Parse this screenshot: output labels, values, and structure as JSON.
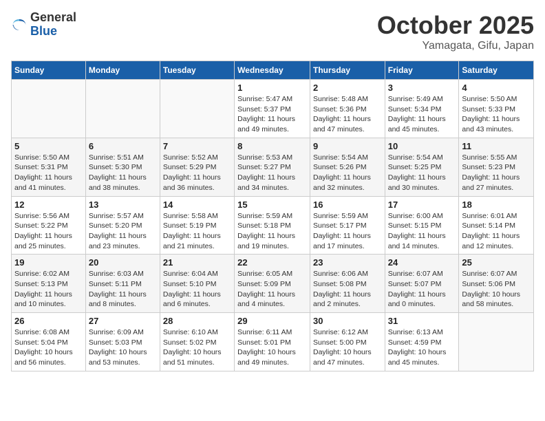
{
  "header": {
    "logo_general": "General",
    "logo_blue": "Blue",
    "month": "October 2025",
    "location": "Yamagata, Gifu, Japan"
  },
  "days_of_week": [
    "Sunday",
    "Monday",
    "Tuesday",
    "Wednesday",
    "Thursday",
    "Friday",
    "Saturday"
  ],
  "weeks": [
    [
      {
        "day": "",
        "info": ""
      },
      {
        "day": "",
        "info": ""
      },
      {
        "day": "",
        "info": ""
      },
      {
        "day": "1",
        "info": "Sunrise: 5:47 AM\nSunset: 5:37 PM\nDaylight: 11 hours\nand 49 minutes."
      },
      {
        "day": "2",
        "info": "Sunrise: 5:48 AM\nSunset: 5:36 PM\nDaylight: 11 hours\nand 47 minutes."
      },
      {
        "day": "3",
        "info": "Sunrise: 5:49 AM\nSunset: 5:34 PM\nDaylight: 11 hours\nand 45 minutes."
      },
      {
        "day": "4",
        "info": "Sunrise: 5:50 AM\nSunset: 5:33 PM\nDaylight: 11 hours\nand 43 minutes."
      }
    ],
    [
      {
        "day": "5",
        "info": "Sunrise: 5:50 AM\nSunset: 5:31 PM\nDaylight: 11 hours\nand 41 minutes."
      },
      {
        "day": "6",
        "info": "Sunrise: 5:51 AM\nSunset: 5:30 PM\nDaylight: 11 hours\nand 38 minutes."
      },
      {
        "day": "7",
        "info": "Sunrise: 5:52 AM\nSunset: 5:29 PM\nDaylight: 11 hours\nand 36 minutes."
      },
      {
        "day": "8",
        "info": "Sunrise: 5:53 AM\nSunset: 5:27 PM\nDaylight: 11 hours\nand 34 minutes."
      },
      {
        "day": "9",
        "info": "Sunrise: 5:54 AM\nSunset: 5:26 PM\nDaylight: 11 hours\nand 32 minutes."
      },
      {
        "day": "10",
        "info": "Sunrise: 5:54 AM\nSunset: 5:25 PM\nDaylight: 11 hours\nand 30 minutes."
      },
      {
        "day": "11",
        "info": "Sunrise: 5:55 AM\nSunset: 5:23 PM\nDaylight: 11 hours\nand 27 minutes."
      }
    ],
    [
      {
        "day": "12",
        "info": "Sunrise: 5:56 AM\nSunset: 5:22 PM\nDaylight: 11 hours\nand 25 minutes."
      },
      {
        "day": "13",
        "info": "Sunrise: 5:57 AM\nSunset: 5:20 PM\nDaylight: 11 hours\nand 23 minutes."
      },
      {
        "day": "14",
        "info": "Sunrise: 5:58 AM\nSunset: 5:19 PM\nDaylight: 11 hours\nand 21 minutes."
      },
      {
        "day": "15",
        "info": "Sunrise: 5:59 AM\nSunset: 5:18 PM\nDaylight: 11 hours\nand 19 minutes."
      },
      {
        "day": "16",
        "info": "Sunrise: 5:59 AM\nSunset: 5:17 PM\nDaylight: 11 hours\nand 17 minutes."
      },
      {
        "day": "17",
        "info": "Sunrise: 6:00 AM\nSunset: 5:15 PM\nDaylight: 11 hours\nand 14 minutes."
      },
      {
        "day": "18",
        "info": "Sunrise: 6:01 AM\nSunset: 5:14 PM\nDaylight: 11 hours\nand 12 minutes."
      }
    ],
    [
      {
        "day": "19",
        "info": "Sunrise: 6:02 AM\nSunset: 5:13 PM\nDaylight: 11 hours\nand 10 minutes."
      },
      {
        "day": "20",
        "info": "Sunrise: 6:03 AM\nSunset: 5:11 PM\nDaylight: 11 hours\nand 8 minutes."
      },
      {
        "day": "21",
        "info": "Sunrise: 6:04 AM\nSunset: 5:10 PM\nDaylight: 11 hours\nand 6 minutes."
      },
      {
        "day": "22",
        "info": "Sunrise: 6:05 AM\nSunset: 5:09 PM\nDaylight: 11 hours\nand 4 minutes."
      },
      {
        "day": "23",
        "info": "Sunrise: 6:06 AM\nSunset: 5:08 PM\nDaylight: 11 hours\nand 2 minutes."
      },
      {
        "day": "24",
        "info": "Sunrise: 6:07 AM\nSunset: 5:07 PM\nDaylight: 11 hours\nand 0 minutes."
      },
      {
        "day": "25",
        "info": "Sunrise: 6:07 AM\nSunset: 5:06 PM\nDaylight: 10 hours\nand 58 minutes."
      }
    ],
    [
      {
        "day": "26",
        "info": "Sunrise: 6:08 AM\nSunset: 5:04 PM\nDaylight: 10 hours\nand 56 minutes."
      },
      {
        "day": "27",
        "info": "Sunrise: 6:09 AM\nSunset: 5:03 PM\nDaylight: 10 hours\nand 53 minutes."
      },
      {
        "day": "28",
        "info": "Sunrise: 6:10 AM\nSunset: 5:02 PM\nDaylight: 10 hours\nand 51 minutes."
      },
      {
        "day": "29",
        "info": "Sunrise: 6:11 AM\nSunset: 5:01 PM\nDaylight: 10 hours\nand 49 minutes."
      },
      {
        "day": "30",
        "info": "Sunrise: 6:12 AM\nSunset: 5:00 PM\nDaylight: 10 hours\nand 47 minutes."
      },
      {
        "day": "31",
        "info": "Sunrise: 6:13 AM\nSunset: 4:59 PM\nDaylight: 10 hours\nand 45 minutes."
      },
      {
        "day": "",
        "info": ""
      }
    ]
  ]
}
